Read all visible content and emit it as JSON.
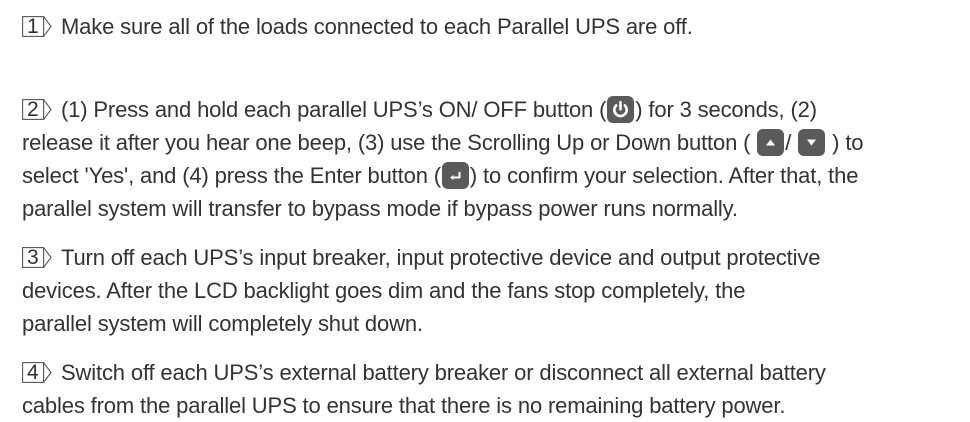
{
  "steps": [
    {
      "number": "1",
      "lines": [
        [
          {
            "t": "text",
            "v": "Make sure all of the loads connected to each Parallel UPS are off."
          }
        ]
      ]
    },
    {
      "number": "2",
      "lines": [
        [
          {
            "t": "text",
            "v": "(1) Press and hold each parallel UPS’s ON/ OFF button ("
          },
          {
            "t": "icon",
            "icon": "power-icon"
          },
          {
            "t": "text",
            "v": ") for 3 seconds, (2)"
          }
        ],
        [
          {
            "t": "text",
            "v": "release it after you hear one beep, (3) use the Scrolling Up or Down button ( "
          },
          {
            "t": "icon",
            "icon": "arrow-up-icon"
          },
          {
            "t": "text",
            "v": "/ "
          },
          {
            "t": "icon",
            "icon": "arrow-down-icon"
          },
          {
            "t": "text",
            "v": " ) to"
          }
        ],
        [
          {
            "t": "text",
            "v": "select 'Yes', and (4) press the Enter button ("
          },
          {
            "t": "icon",
            "icon": "enter-icon"
          },
          {
            "t": "text",
            "v": ") to confirm your selection. After that, the"
          }
        ],
        [
          {
            "t": "text",
            "v": "parallel system will transfer to bypass mode if bypass power runs normally."
          }
        ]
      ]
    },
    {
      "number": "3",
      "lines": [
        [
          {
            "t": "text",
            "v": "Turn off each UPS’s input breaker, input protective device and output protective"
          }
        ],
        [
          {
            "t": "text",
            "v": "devices. After the LCD backlight goes dim and the fans stop completely, the"
          }
        ],
        [
          {
            "t": "text",
            "v": "parallel system will completely shut down."
          }
        ]
      ]
    },
    {
      "number": "4",
      "lines": [
        [
          {
            "t": "text",
            "v": "Switch off each UPS’s external battery breaker or disconnect all external battery"
          }
        ],
        [
          {
            "t": "text",
            "v": "cables from the parallel UPS to ensure that there is no remaining battery power."
          }
        ]
      ]
    }
  ]
}
